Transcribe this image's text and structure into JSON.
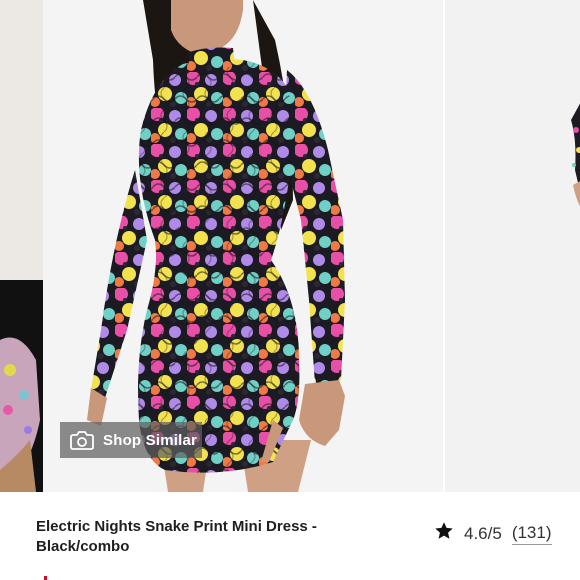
{
  "carousel": {
    "shop_similar_label": "Shop Similar"
  },
  "product": {
    "title_line1": "Electric Nights Snake Print Mini Dress -",
    "title_line2": "Black/combo",
    "rating_value": "4.6/5",
    "review_count": "(131)"
  },
  "icons": {
    "camera": "camera-icon",
    "star": "star-icon"
  },
  "colors": {
    "overlay": "#5f5f5f",
    "text": "#1f1f1f",
    "accent": "#c8102e"
  }
}
